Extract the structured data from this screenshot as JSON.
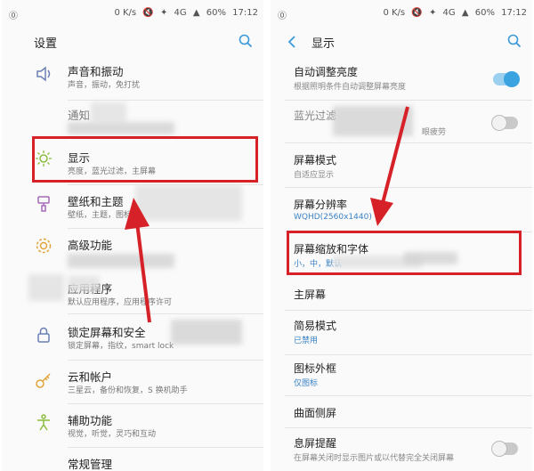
{
  "status": {
    "speed": "0 K/s",
    "network": "4G",
    "battery": "60%",
    "time": "17:12"
  },
  "left": {
    "title": "设置",
    "items": [
      {
        "title": "声音和振动",
        "sub": "声音，振动，免打扰"
      },
      {
        "title": "通知",
        "sub": ""
      },
      {
        "title": "显示",
        "sub": "亮度，蓝光过滤，主屏幕"
      },
      {
        "title": "壁纸和主题",
        "sub": "壁纸，主题，图标"
      },
      {
        "title": "高级功能",
        "sub": ""
      },
      {
        "title": "应用程序",
        "sub": "默认应用程序，应用程序许可"
      },
      {
        "title": "锁定屏幕和安全",
        "sub": "锁定屏幕，指纹，smart lock"
      },
      {
        "title": "云和帐户",
        "sub": "三星云，备份和恢复，S 换机助手"
      },
      {
        "title": "辅助功能",
        "sub": "视觉，听觉，灵巧和互动"
      },
      {
        "title": "常规管理",
        "sub": ""
      }
    ]
  },
  "right": {
    "title": "显示",
    "items": [
      {
        "title": "自动调整亮度",
        "sub": "根据照明条件自动调整屏幕亮度"
      },
      {
        "title": "蓝光过滤",
        "sub": "眼疲劳"
      },
      {
        "title": "屏幕模式",
        "sub": "自适应显示"
      },
      {
        "title": "屏幕分辨率",
        "sub": "WQHD(2560x1440)"
      },
      {
        "title": "屏幕缩放和字体",
        "sub": "小，中，默认"
      },
      {
        "title": "主屏幕",
        "sub": ""
      },
      {
        "title": "简易模式",
        "sub": "已禁用"
      },
      {
        "title": "图标外框",
        "sub": "仅图标"
      },
      {
        "title": "曲面侧屏",
        "sub": ""
      },
      {
        "title": "息屏提醒",
        "sub": "在屏幕关闭时显示图片或以代替完全关闭屏幕"
      }
    ]
  },
  "colors": {
    "highlight": "#d62128",
    "accent": "#3aa3e0",
    "link": "#3b83c4"
  }
}
